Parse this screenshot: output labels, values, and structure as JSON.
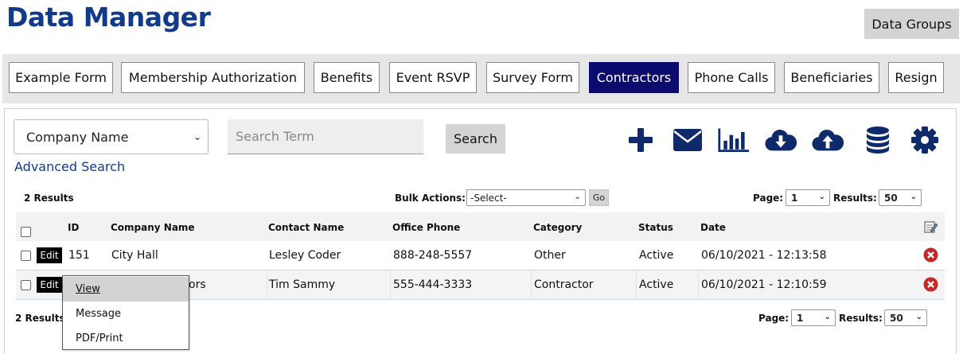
{
  "app": {
    "title": "Data Manager",
    "data_groups_label": "Data Groups"
  },
  "tabs": [
    {
      "label": "Example Form"
    },
    {
      "label": "Membership Authorization"
    },
    {
      "label": "Benefits"
    },
    {
      "label": "Event RSVP"
    },
    {
      "label": "Survey Form"
    },
    {
      "label": "Contractors",
      "active": true
    },
    {
      "label": "Phone Calls"
    },
    {
      "label": "Beneficiaries"
    },
    {
      "label": "Resign"
    }
  ],
  "search": {
    "field_selected": "Company Name",
    "placeholder": "Search Term",
    "value": "",
    "button_label": "Search",
    "advanced_link": "Advanced Search"
  },
  "toolbar_icons": [
    "add-icon",
    "envelope-icon",
    "bar-chart-icon",
    "cloud-download-icon",
    "cloud-upload-icon",
    "database-icon",
    "gear-icon"
  ],
  "colors": {
    "accent": "#123a8a",
    "active_tab": "#0b0b6e",
    "icon": "#0f2a6b",
    "delete": "#c62828"
  },
  "results": {
    "count_label": "2 Results",
    "bulk_label": "Bulk Actions:",
    "bulk_selected": "-Select-",
    "go_label": "Go",
    "page_label": "Page:",
    "page_value": "1",
    "results_label": "Results:",
    "per_page_value": "50"
  },
  "table": {
    "headers": {
      "id": "ID",
      "company": "Company Name",
      "contact": "Contact Name",
      "phone": "Office Phone",
      "category": "Category",
      "status": "Status",
      "date": "Date"
    },
    "rows": [
      {
        "edit": "Edit",
        "id": "151",
        "company": "City Hall",
        "contact": "Lesley Coder",
        "phone": "888-248-5557",
        "category": "Other",
        "status": "Active",
        "date": "06/10/2021 - 12:13:58"
      },
      {
        "edit": "Edit",
        "id": "",
        "company": "ors",
        "contact": "Tim Sammy",
        "phone": "555-444-3333",
        "category": "Contractor",
        "status": "Active",
        "date": "06/10/2021 - 12:10:59"
      }
    ]
  },
  "context_menu": {
    "items": [
      {
        "label": "View"
      },
      {
        "label": "Message"
      },
      {
        "label": "PDF/Print"
      }
    ]
  }
}
